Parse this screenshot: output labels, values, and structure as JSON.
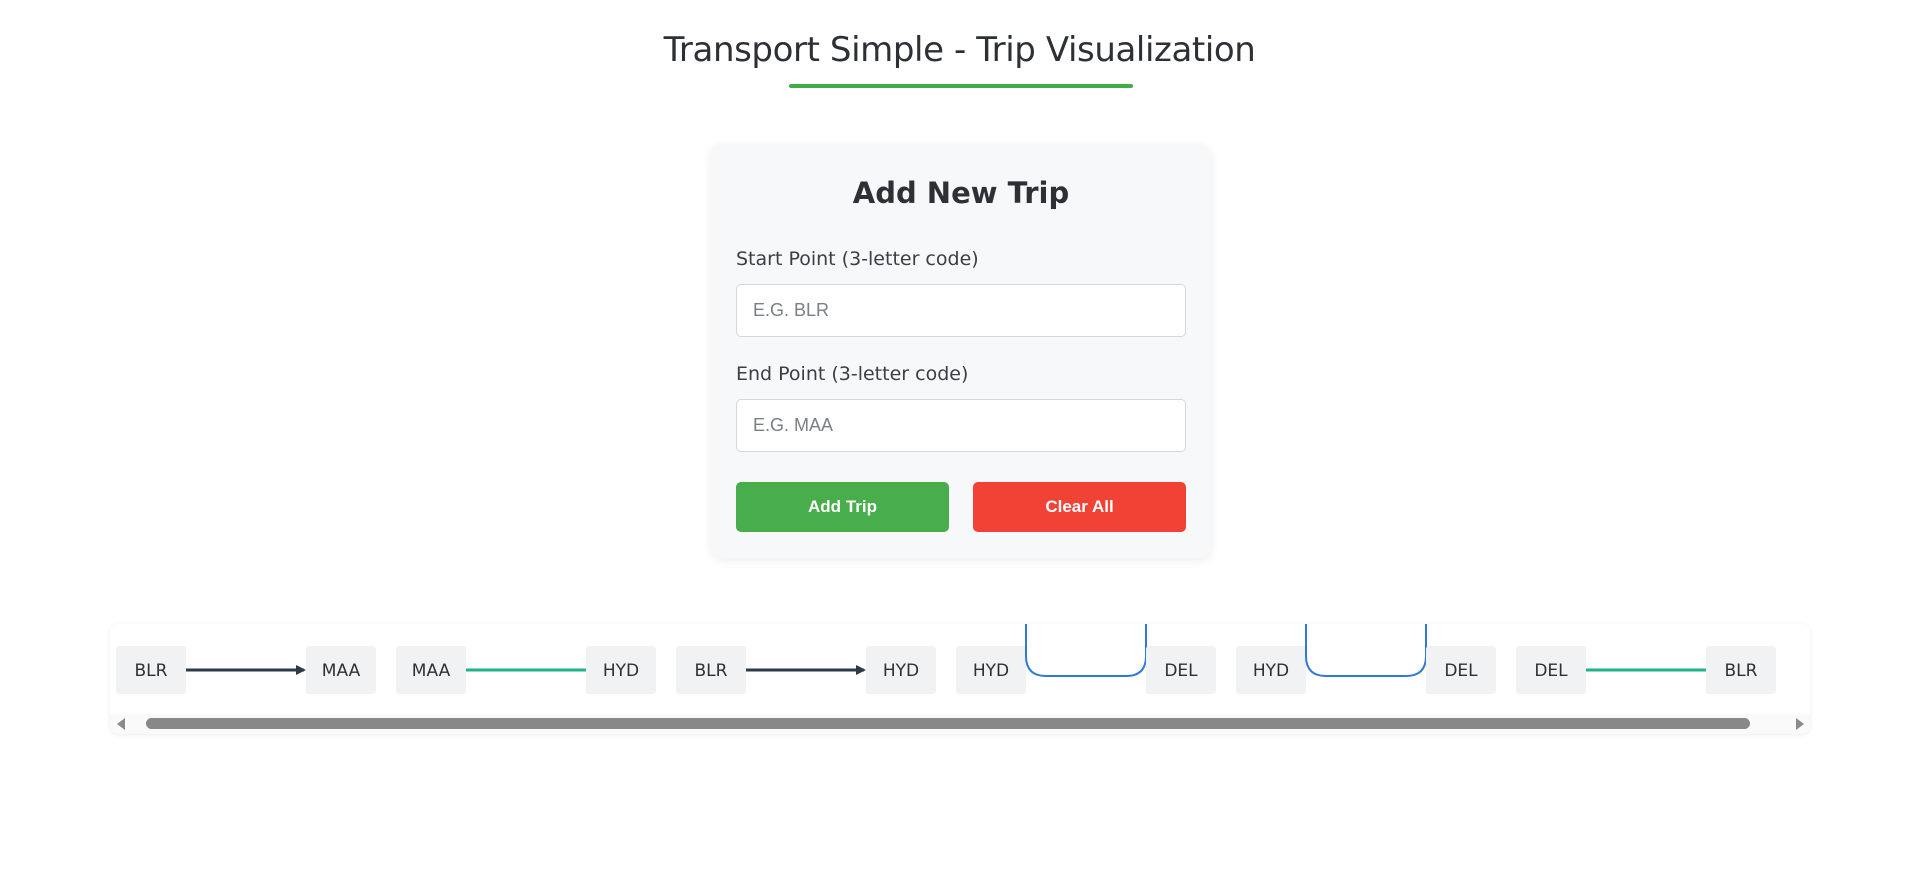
{
  "header": {
    "title": "Transport Simple - Trip Visualization",
    "accent_color": "#41ad49"
  },
  "form": {
    "title": "Add New Trip",
    "start_label": "Start Point (3-letter code)",
    "start_placeholder": "E.G. BLR",
    "start_value": "",
    "end_label": "End Point (3-letter code)",
    "end_placeholder": "E.G. MAA",
    "end_value": "",
    "add_button": "Add Trip",
    "clear_button": "Clear All",
    "add_color": "#47ae4b",
    "clear_color": "#f24236"
  },
  "trips": [
    {
      "start": "BLR",
      "end": "MAA",
      "connector": "arrow"
    },
    {
      "start": "MAA",
      "end": "HYD",
      "connector": "line"
    },
    {
      "start": "BLR",
      "end": "HYD",
      "connector": "arrow"
    },
    {
      "start": "HYD",
      "end": "DEL",
      "connector": "loop"
    },
    {
      "start": "HYD",
      "end": "DEL",
      "connector": "loop"
    },
    {
      "start": "DEL",
      "end": "BLR",
      "connector": "line"
    }
  ],
  "connector_colors": {
    "arrow": "#2d3a4a",
    "line": "#1fb389",
    "loop": "#2f7ad8"
  }
}
